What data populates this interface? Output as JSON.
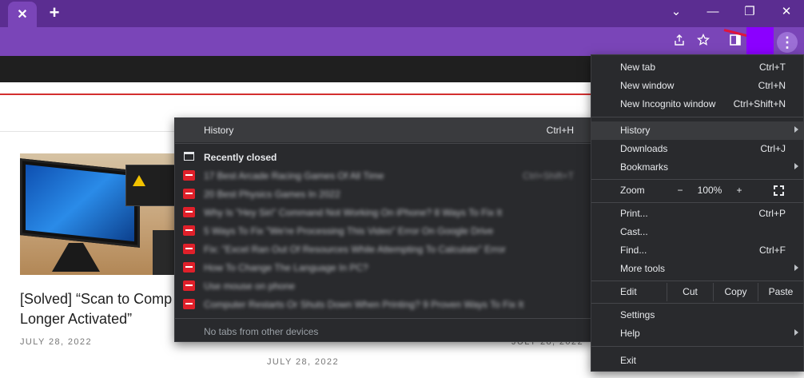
{
  "titlebar": {
    "tab_close_glyph": "✕",
    "new_tab_glyph": "+",
    "controls": [
      "⌄",
      "—",
      "❐",
      "✕"
    ]
  },
  "toolbar": {
    "icons": [
      "share-icon",
      "star-icon",
      "side-panel-icon"
    ],
    "menu_glyph": "⋮"
  },
  "page": {
    "article_title_line1": "[Solved] “Scan to Comp",
    "article_title_line2": "Longer Activated”",
    "date_left": "JULY 28, 2022",
    "date_center": "JULY 28, 2022",
    "date_right": "JULY 28, 2022"
  },
  "history_submenu": {
    "header_label": "History",
    "header_shortcut": "Ctrl+H",
    "recently_closed_label": "Recently closed",
    "items": [
      {
        "title": "17 Best Arcade Racing Games Of All Time",
        "shortcut": "Ctrl+Shift+T"
      },
      {
        "title": "20 Best Physics Games In 2022",
        "shortcut": ""
      },
      {
        "title": "Why Is \"Hey Siri\" Command Not Working On iPhone? 8 Ways To Fix It",
        "shortcut": ""
      },
      {
        "title": "5 Ways To Fix \"We're Processing This Video\" Error On Google Drive",
        "shortcut": ""
      },
      {
        "title": "Fix: \"Excel Ran Out Of Resources While Attempting To Calculate\" Error",
        "shortcut": ""
      },
      {
        "title": "How To Change The Language In PC?",
        "shortcut": ""
      },
      {
        "title": "Use mouse on phone",
        "shortcut": ""
      },
      {
        "title": "Computer Restarts Or Shuts Down When Printing? 9 Proven Ways To Fix It",
        "shortcut": ""
      }
    ],
    "no_tabs_label": "No tabs from other devices"
  },
  "main_menu": {
    "new_tab": {
      "label": "New tab",
      "shortcut": "Ctrl+T"
    },
    "new_window": {
      "label": "New window",
      "shortcut": "Ctrl+N"
    },
    "new_incognito": {
      "label": "New Incognito window",
      "shortcut": "Ctrl+Shift+N"
    },
    "history": {
      "label": "History"
    },
    "downloads": {
      "label": "Downloads",
      "shortcut": "Ctrl+J"
    },
    "bookmarks": {
      "label": "Bookmarks"
    },
    "zoom": {
      "label": "Zoom",
      "minus": "−",
      "value": "100%",
      "plus": "+"
    },
    "print": {
      "label": "Print...",
      "shortcut": "Ctrl+P"
    },
    "cast": {
      "label": "Cast..."
    },
    "find": {
      "label": "Find...",
      "shortcut": "Ctrl+F"
    },
    "more_tools": {
      "label": "More tools"
    },
    "edit": {
      "label": "Edit",
      "cut": "Cut",
      "copy": "Copy",
      "paste": "Paste"
    },
    "settings": {
      "label": "Settings"
    },
    "help": {
      "label": "Help"
    },
    "exit": {
      "label": "Exit"
    }
  },
  "colors": {
    "titlebar": "#5b2d91",
    "toolbar": "#7a45b8",
    "menu_bg": "#292a2d",
    "accent_red": "#d32f2f"
  }
}
